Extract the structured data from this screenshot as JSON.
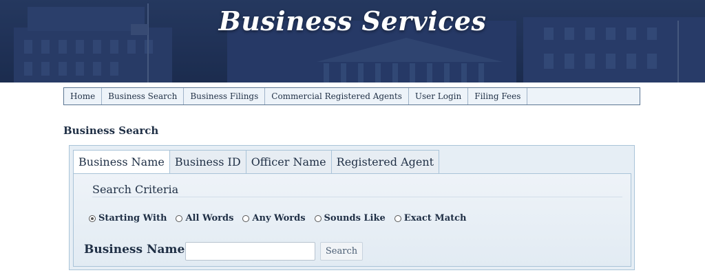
{
  "banner": {
    "title": "Business Services"
  },
  "nav": {
    "items": [
      {
        "label": "Home"
      },
      {
        "label": "Business Search"
      },
      {
        "label": "Business Filings"
      },
      {
        "label": "Commercial Registered Agents"
      },
      {
        "label": "User Login"
      },
      {
        "label": "Filing Fees"
      }
    ]
  },
  "page": {
    "heading": "Business Search"
  },
  "search": {
    "tabs": [
      {
        "label": "Business Name",
        "active": true
      },
      {
        "label": "Business ID"
      },
      {
        "label": "Officer Name"
      },
      {
        "label": "Registered Agent"
      }
    ],
    "criteria_title": "Search Criteria",
    "options": [
      {
        "label": "Starting With",
        "checked": true
      },
      {
        "label": "All Words"
      },
      {
        "label": "Any Words"
      },
      {
        "label": "Sounds Like"
      },
      {
        "label": "Exact Match"
      }
    ],
    "field_label": "Business Name:",
    "field_value": "",
    "button_label": "Search"
  },
  "colors": {
    "banner": "#22355a",
    "text": "#1f2f45",
    "panel": "#e6eef5"
  }
}
